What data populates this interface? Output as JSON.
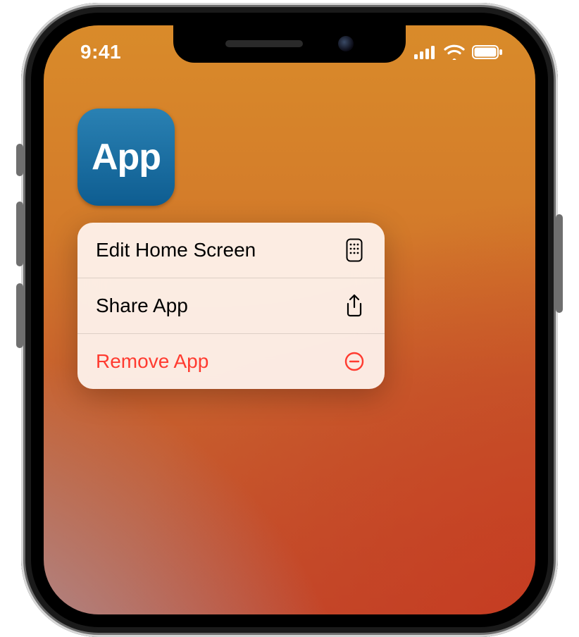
{
  "statusbar": {
    "time": "9:41"
  },
  "app": {
    "label": "App"
  },
  "menu": {
    "items": [
      {
        "label": "Edit Home Screen",
        "icon": "apps-grid-icon",
        "destructive": false
      },
      {
        "label": "Share App",
        "icon": "share-icon",
        "destructive": false
      },
      {
        "label": "Remove App",
        "icon": "minus-circle-icon",
        "destructive": true
      }
    ]
  },
  "colors": {
    "destructive": "#ff3b30",
    "app_icon_bg": "#1e6da0"
  }
}
